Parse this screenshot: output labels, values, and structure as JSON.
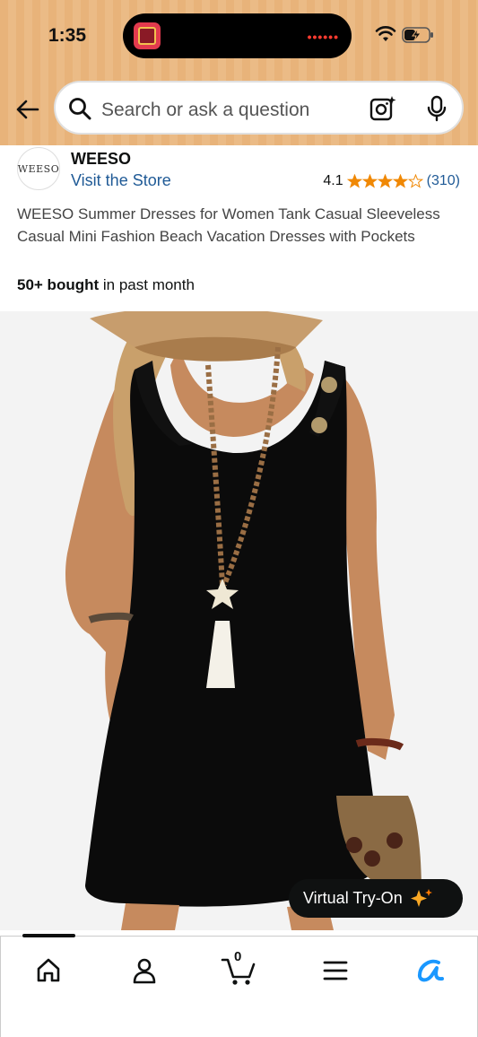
{
  "status_bar": {
    "time": "1:35",
    "recording_indicator": "••••••",
    "icons": [
      "wifi-icon",
      "battery-charging-icon"
    ]
  },
  "search": {
    "placeholder": "Search or ask a question",
    "icons": [
      "back-arrow-icon",
      "search-icon",
      "camera-lens-icon",
      "microphone-icon"
    ]
  },
  "store": {
    "logo_text": "WEESO",
    "name": "WEESO",
    "link_label": "Visit the Store",
    "rating": "4.1",
    "rating_count": "(310)",
    "stars_filled": 4.1,
    "star_color": "#f08804"
  },
  "product": {
    "title": "WEESO Summer Dresses for Women Tank Casual Sleeveless Casual Mini Fashion Beach Vacation Dresses with Pockets",
    "bought_count": "50+ bought",
    "bought_suffix": " in past month",
    "virtual_try_on_label": "Virtual Try-On"
  },
  "bottom_nav": {
    "items": [
      "home-icon",
      "account-icon",
      "cart-icon",
      "menu-icon",
      "rufus-ai-icon"
    ],
    "cart_count": "0",
    "accent_color": "#1a98ff"
  },
  "colors": {
    "header_bg": "#e8b37a",
    "link": "#1f5a96",
    "text": "#0f1111"
  }
}
